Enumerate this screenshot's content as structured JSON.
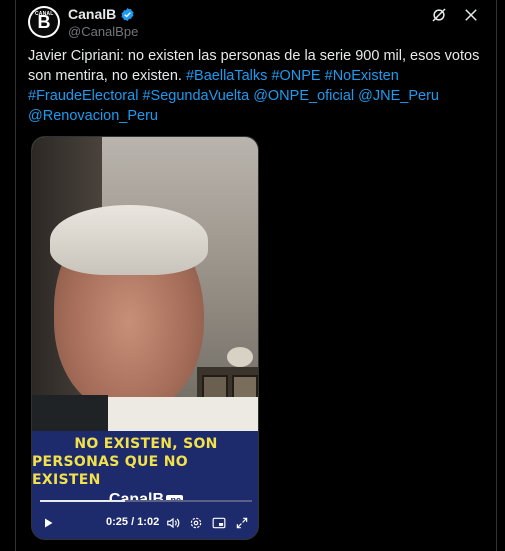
{
  "author": {
    "avatar_letter": "B",
    "avatar_small": "CANAL",
    "display_name": "CanalB",
    "handle": "@CanalBpe"
  },
  "tweet": {
    "text_plain": "Javier Cipriani: no existen las personas de la serie 900 mil, esos votos son mentira, no existen.",
    "hashtags": [
      "#BaellaTalks",
      "#ONPE",
      "#NoExisten",
      "#FraudeElectoral",
      "#SegundaVuelta"
    ],
    "mentions": [
      "@ONPE_oficial",
      "@JNE_Peru",
      "@Renovacion_Peru"
    ]
  },
  "video": {
    "banner_line1": "NO EXISTEN, SON",
    "banner_line2": "PERSONAS QUE NO EXISTEN",
    "brand": "CanalB",
    "brand_tld": ".pe",
    "time": "0:25 / 1:02",
    "progress_fraction": 0.403
  },
  "icons": {
    "verified": "verified-badge-icon",
    "grok": "grok-icon",
    "close": "close-icon",
    "play": "play-icon",
    "volume": "volume-icon",
    "settings": "settings-icon",
    "pip": "picture-in-picture-icon",
    "fullscreen": "fullscreen-icon"
  },
  "colors": {
    "link": "#1d9bf0",
    "background": "#000000",
    "muted": "#71767b"
  }
}
